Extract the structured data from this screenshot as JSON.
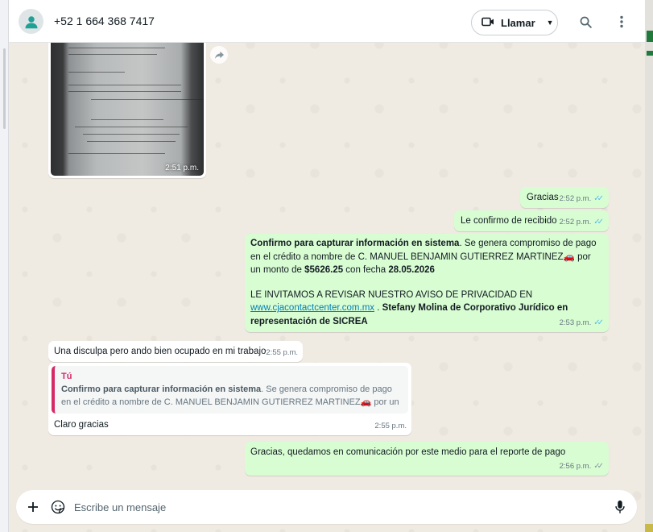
{
  "header": {
    "contact_name": "+52 1 664 368 7417",
    "call_label": "Llamar"
  },
  "messages": {
    "image_time": "2:51 p.m.",
    "m1": {
      "text": "Gracias",
      "time": "2:52 p.m."
    },
    "m2": {
      "text": "Le confirmo de recibido",
      "time": "2:52 p.m."
    },
    "m3": {
      "bold1": "Confirmo para capturar información en sistema",
      "t1": ". Se genera compromiso de pago en el crédito a nombre de C. MANUEL BENJAMIN GUTIERREZ MARTINEZ",
      "emoji": "🚗",
      "t2": "  por un monto de ",
      "amount": "$5626.25",
      "t3": " con fecha ",
      "date": "28.05.2026",
      "t4": "LE INVITAMOS A REVISAR NUESTRO AVISO DE PRIVACIDAD EN",
      "link": "www.cjacontactcenter.com.mx",
      "t5": " . ",
      "bold2": "Stefany Molina de Corporativo Jurídico en representación de SICREA",
      "time": "2:53 p.m."
    },
    "m4": {
      "text": "Una disculpa pero ando bien ocupado en mi trabajo",
      "time": "2:55 p.m."
    },
    "m5": {
      "quote_author": "Tú",
      "quote_bold": "Confirmo para capturar información en sistema",
      "quote_text": ". Se genera compromiso de pago en el crédito a nombre de C. MANUEL BENJAMIN GUTIERREZ MARTINEZ",
      "quote_emoji": "🚗",
      "quote_tail": " por un monto de ...",
      "text": "Claro gracias",
      "time": "2:55 p.m."
    },
    "m6": {
      "text": "Gracias, quedamos en comunicación por este medio para el reporte de pago",
      "time": "2:56 p.m."
    }
  },
  "composer": {
    "placeholder": "Escribe un mensaje"
  },
  "colors": {
    "outgoing_bubble": "#d9fdd3",
    "incoming_bubble": "#ffffff",
    "read_ticks": "#53bdeb",
    "quote_accent": "#d42a66",
    "link": "#027eb5"
  },
  "icons": [
    "contact-avatar-icon",
    "video-call-icon",
    "chevron-down-icon",
    "search-icon",
    "menu-dots-icon",
    "forward-icon",
    "plus-icon",
    "sticker-icon",
    "mic-icon"
  ]
}
